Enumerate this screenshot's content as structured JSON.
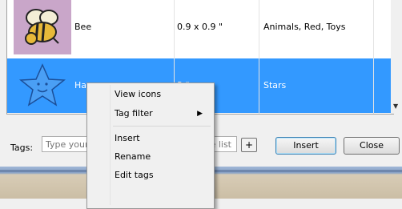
{
  "rows": [
    {
      "name": "Bee",
      "size": "0.9 x 0.9 \"",
      "tags": "Animals, Red, Toys",
      "thumb_icon": "bee-icon"
    },
    {
      "name": "Ha",
      "size": "3 \"",
      "tags": "Stars",
      "thumb_icon": "star-icon"
    }
  ],
  "tags_bar": {
    "label": "Tags:",
    "placeholder": "Type your",
    "list_fragment": "e list",
    "plus": "+"
  },
  "buttons": {
    "insert": "Insert",
    "close": "Close"
  },
  "context_menu": {
    "view_icons": "View icons",
    "tag_filter": "Tag filter",
    "insert": "Insert",
    "rename": "Rename",
    "edit_tags": "Edit tags"
  },
  "colors": {
    "selection": "#3399ff",
    "thumb_bg": "#c9a6c9"
  }
}
